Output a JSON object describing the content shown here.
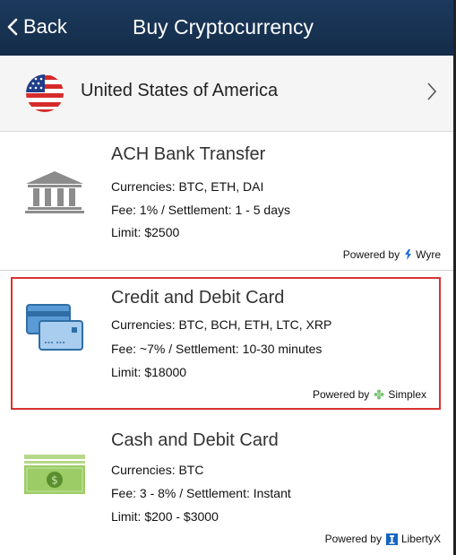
{
  "header": {
    "back_label": "Back",
    "title": "Buy Cryptocurrency"
  },
  "country": {
    "name": "United States of America",
    "flag_icon": "us-flag-icon"
  },
  "methods": [
    {
      "title": "ACH Bank Transfer",
      "currencies": "Currencies: BTC, ETH, DAI",
      "fee": "Fee: 1% / Settlement: 1 - 5 days",
      "limit": "Limit: $2500",
      "powered_by": "Powered by",
      "provider": "Wyre",
      "icon": "bank-icon",
      "selected": false
    },
    {
      "title": "Credit and Debit Card",
      "currencies": "Currencies: BTC, BCH, ETH, LTC, XRP",
      "fee": "Fee: ~7% / Settlement: 10-30 minutes",
      "limit": "Limit: $18000",
      "powered_by": "Powered by",
      "provider": "Simplex",
      "icon": "credit-card-icon",
      "selected": true
    },
    {
      "title": "Cash and Debit Card",
      "currencies": "Currencies: BTC",
      "fee": "Fee: 3 - 8% / Settlement: Instant",
      "limit": "Limit: $200 - $3000",
      "powered_by": "Powered by",
      "provider": "LibertyX",
      "icon": "cash-icon",
      "selected": false
    }
  ],
  "colors": {
    "header_bg": "#1c3a5e",
    "selected_border": "#d93333",
    "card_icon_blue": "#3e7fb8",
    "cash_green": "#8bc34a",
    "wyre_blue": "#1e6fd9",
    "simplex_green": "#7cc576",
    "libertyx_blue": "#1565c0"
  }
}
